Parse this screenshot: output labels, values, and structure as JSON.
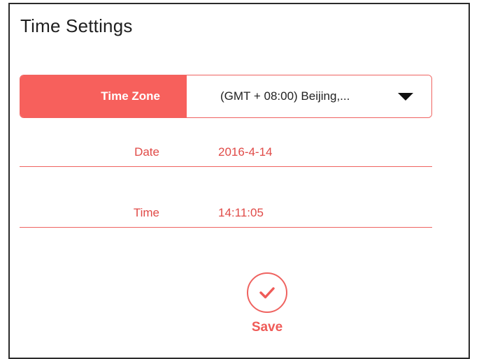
{
  "page": {
    "title": "Time Settings"
  },
  "time_zone": {
    "label": "Time Zone",
    "selected": "(GMT + 08:00) Beijing,..."
  },
  "date": {
    "label": "Date",
    "value": "2016-4-14"
  },
  "time": {
    "label": "Time",
    "value": "14:11:05"
  },
  "actions": {
    "save_label": "Save"
  },
  "colors": {
    "accent": "#f7605c",
    "text_accent": "#e04a47"
  },
  "icons": {
    "dropdown": "caret-down-icon",
    "save": "check-circle-icon"
  }
}
